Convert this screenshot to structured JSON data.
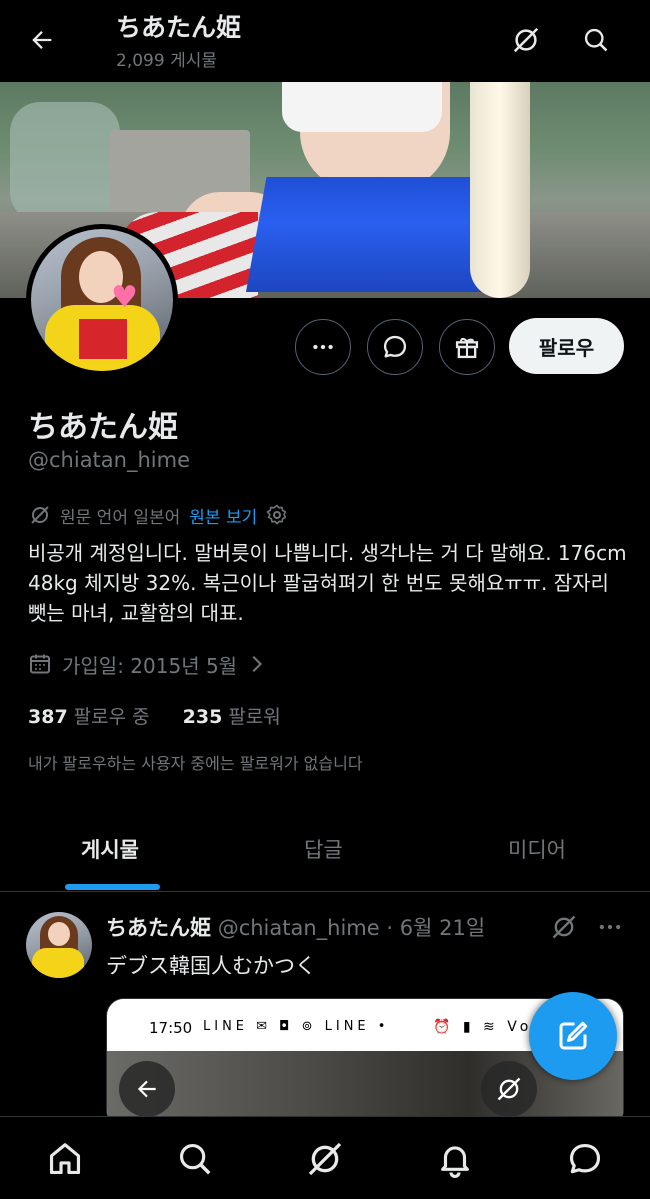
{
  "topbar": {
    "title": "ちあたん姫",
    "subtitle": "2,099 게시물",
    "back_icon": "arrow-left-icon",
    "grok_icon": "grok-icon",
    "search_icon": "search-icon"
  },
  "profile": {
    "name": "ちあたん姫",
    "handle": "@chiatan_hime",
    "follow_label": "팔로우",
    "more_icon": "more-horizontal-icon",
    "message_icon": "message-icon",
    "gift_icon": "gift-icon",
    "translate": {
      "original_language": "원문 언어 일본어",
      "show_original": "원본 보기"
    },
    "bio": "비공개 계정입니다. 말버릇이 나쁩니다. 생각나는 거 다 말해요. 176cm 48kg 체지방 32%. 복근이나 팔굽혀펴기 한 번도 못해요ㅠㅠ. 잠자리 뺏는 마녀, 교활함의 대표.",
    "joined": "가입일: 2015년 5월",
    "following_count": "387",
    "following_label": "팔로우 중",
    "followers_count": "235",
    "followers_label": "팔로워",
    "mutual_note": "내가 팔로우하는 사용자 중에는 팔로워가 없습니다"
  },
  "tabs": [
    {
      "label": "게시물",
      "active": true
    },
    {
      "label": "답글",
      "active": false
    },
    {
      "label": "미디어",
      "active": false
    }
  ],
  "tweet": {
    "name": "ちあたん姫",
    "handle": "@chiatan_hime",
    "separator": "·",
    "date": "6월 21일",
    "text": "デブス韓国人むかつく",
    "media": {
      "status_time": "17:50",
      "status_icons_left": "LINE ✉ ◘ ⊚ LINE •",
      "status_icons_right": "⏰ ▮ ≋ Vo LTE"
    }
  },
  "bottom_nav": [
    "home-icon",
    "search-icon",
    "grok-icon",
    "notifications-icon",
    "messages-icon"
  ],
  "colors": {
    "accent": "#1d9bf0",
    "background": "#000000",
    "text_primary": "#e7e9ea",
    "text_secondary": "#71767b",
    "border": "#2f3336"
  }
}
